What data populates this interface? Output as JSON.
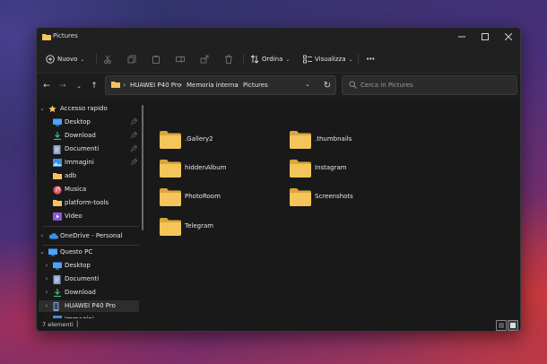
{
  "window": {
    "title": "Pictures",
    "controls": [
      "minimize",
      "maximize",
      "close"
    ]
  },
  "toolbar": {
    "new_label": "Nuovo",
    "sort_label": "Ordina",
    "view_label": "Visualizza",
    "more_label": "•••"
  },
  "address": {
    "crumbs": [
      "HUAWEI P40 Pro",
      "Memoria interna",
      "Pictures"
    ],
    "search_placeholder": "Cerca in Pictures"
  },
  "sidebar": {
    "quick_access": "Accesso rapido",
    "quick_items": [
      {
        "label": "Desktop",
        "icon": "desktop-icon",
        "pinned": true
      },
      {
        "label": "Download",
        "icon": "download-icon",
        "pinned": true
      },
      {
        "label": "Documenti",
        "icon": "documents-icon",
        "pinned": true
      },
      {
        "label": "Immagini",
        "icon": "pictures-icon",
        "pinned": true
      },
      {
        "label": "adb",
        "icon": "folder-icon",
        "pinned": false
      },
      {
        "label": "Musica",
        "icon": "music-icon",
        "pinned": false
      },
      {
        "label": "platform-tools",
        "icon": "folder-icon",
        "pinned": false
      },
      {
        "label": "Video",
        "icon": "video-icon",
        "pinned": false
      }
    ],
    "onedrive": "OneDrive - Personal",
    "this_pc": "Questo PC",
    "pc_items": [
      {
        "label": "Desktop",
        "icon": "desktop-icon"
      },
      {
        "label": "Documenti",
        "icon": "documents-icon"
      },
      {
        "label": "Download",
        "icon": "download-icon"
      },
      {
        "label": "HUAWEI P40 Pro",
        "icon": "phone-icon",
        "selected": true
      },
      {
        "label": "Immagini",
        "icon": "pictures-icon"
      }
    ]
  },
  "folders": [
    ".Gallery2",
    ".thumbnails",
    "hiddenAlbum",
    "Instagram",
    "PhotoRoom",
    "Screenshots",
    "Telegram"
  ],
  "status": {
    "count": "7 elementi"
  },
  "colors": {
    "folder": "#f4c55a",
    "folder_dark": "#d9a53c",
    "accent": "#4aa3ff",
    "selected_bg": "#2d2d2d"
  }
}
